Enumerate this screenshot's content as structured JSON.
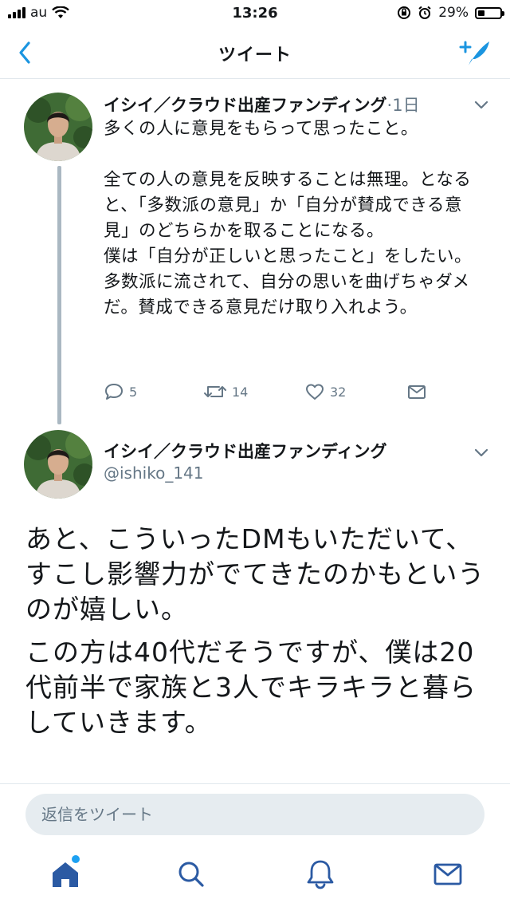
{
  "status_bar": {
    "carrier": "au",
    "time": "13:26",
    "battery_text": "29%",
    "battery_level": 0.29
  },
  "nav": {
    "title": "ツイート",
    "back_icon": "chevron-left-icon",
    "compose_icon": "compose-tweet-icon"
  },
  "tweet1": {
    "author": "イシイ／クラウド出産ファンディング",
    "age": "·1日",
    "body": "多くの人に意見をもらって思ったこと。\n\n全ての人の意見を反映することは無理。となると、「多数派の意見」か「自分が賛成できる意見」のどちらかを取ることになる。\n僕は「自分が正しいと思ったこと」をしたい。多数派に流されて、自分の思いを曲げちゃダメだ。賛成できる意見だけ取り入れよう。",
    "replies": "5",
    "retweets": "14",
    "likes": "32"
  },
  "tweet2": {
    "author": "イシイ／クラウド出産ファンディング",
    "handle": "@ishiko_141",
    "paragraphs": [
      "あと、こういったDMもいただいて、すこし影響力がでてきたのかもというのが嬉しい。",
      "この方は40代だそうですが、僕は20代前半で家族と3人でキラキラと暮らしていきます。"
    ]
  },
  "reply": {
    "placeholder": "返信をツイート"
  },
  "tab_bar": {
    "items": [
      "home-icon",
      "search-icon",
      "notifications-icon",
      "messages-icon"
    ]
  },
  "colors": {
    "accent": "#1da1f2",
    "nav_blue": "#1b95e0",
    "secondary_text": "#657786",
    "thread_line": "#aab8c2",
    "tab_icon": "#2b5aa3"
  }
}
